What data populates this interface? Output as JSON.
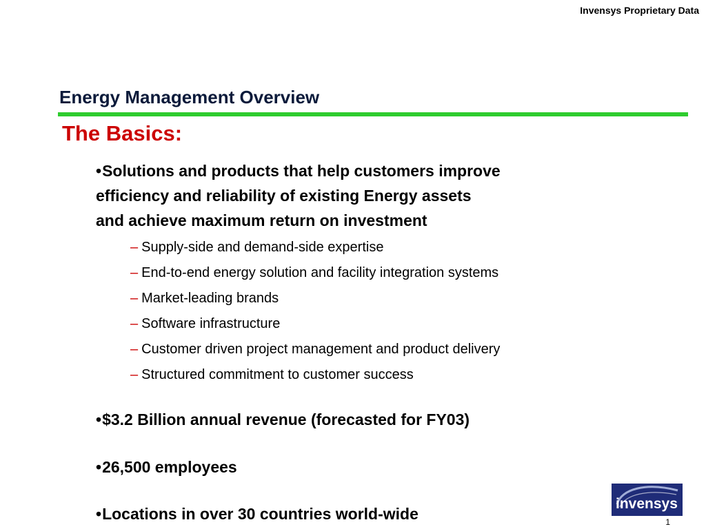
{
  "header": {
    "proprietary": "Invensys Proprietary Data"
  },
  "slide": {
    "title": "Energy Management Overview",
    "subtitle": "The Basics:",
    "bullets": [
      {
        "bullet": "•",
        "lines": [
          "Solutions and products that help customers improve",
          "efficiency and reliability of existing Energy assets",
          "and achieve maximum return on  investment"
        ]
      },
      {
        "bullet": "•",
        "text": "$3.2 Billion annual revenue (forecasted for FY03)"
      },
      {
        "bullet": "•",
        "text": "26,500 employees"
      },
      {
        "bullet": "•",
        "text": "Locations in over 30 countries world-wide"
      }
    ],
    "sub_bullet_marker": "–",
    "sub_bullets": [
      "Supply-side and demand-side expertise",
      "End-to-end energy solution and facility integration systems",
      "Market-leading brands",
      "Software infrastructure",
      "Customer driven project management and product delivery",
      "Structured commitment to customer success"
    ]
  },
  "logo": {
    "text": "invensys"
  },
  "footer": {
    "page_number": "1"
  },
  "colors": {
    "title": "#0b1a3a",
    "subtitle": "#cc0000",
    "rule": "#2ecc2e",
    "dash": "#cc0000",
    "logo_bg": "#1f2c78"
  }
}
